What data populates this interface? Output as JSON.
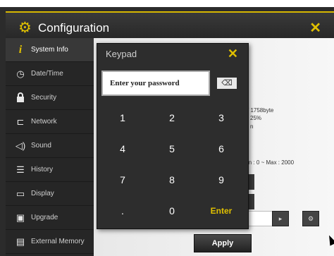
{
  "window": {
    "title": "Configuration",
    "title_icon": "gear-icon",
    "close": "✕"
  },
  "sidebar": {
    "items": [
      {
        "label": "System Info",
        "icon": "info-icon",
        "glyph": "i",
        "active": true
      },
      {
        "label": "Date/Time",
        "icon": "clock-icon",
        "glyph": "◷"
      },
      {
        "label": "Security",
        "icon": "lock-icon",
        "glyph": "🔒"
      },
      {
        "label": "Network",
        "icon": "network-icon",
        "glyph": "⊏"
      },
      {
        "label": "Sound",
        "icon": "speaker-icon",
        "glyph": "◁)"
      },
      {
        "label": "History",
        "icon": "list-icon",
        "glyph": "☰"
      },
      {
        "label": "Display",
        "icon": "monitor-icon",
        "glyph": "▭"
      },
      {
        "label": "Upgrade",
        "icon": "upgrade-icon",
        "glyph": "▣"
      },
      {
        "label": "External Memory",
        "icon": "memory-icon",
        "glyph": "▤"
      }
    ]
  },
  "content": {
    "text_memory": "/ 1758byte",
    "text_percent": "25%",
    "text_extra": "n",
    "text_range": "in : 0 ~ Max : 2000",
    "apply_label": "Apply",
    "next_glyph": "▸",
    "settings_glyph": "⚙"
  },
  "keypad": {
    "title": "Keypad",
    "close": "✕",
    "input_placeholder": "Enter your password",
    "backspace": "⌫",
    "keys": [
      "1",
      "2",
      "3",
      "4",
      "5",
      "6",
      "7",
      "8",
      "9",
      ".",
      "0",
      "Enter"
    ]
  },
  "colors": {
    "accent": "#e0c000",
    "window_bg": "#2b2b2b",
    "sidebar_active": "#383838"
  }
}
